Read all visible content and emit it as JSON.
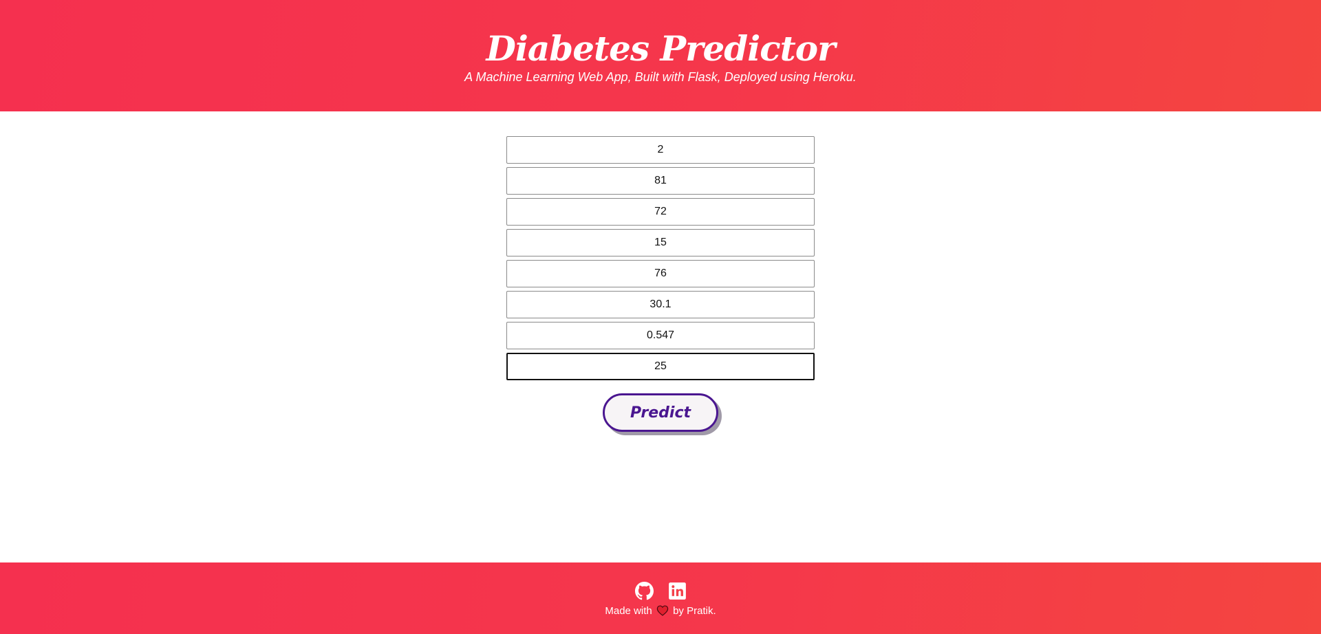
{
  "header": {
    "title": "Diabetes Predictor",
    "subtitle": "A Machine Learning Web App, Built with Flask, Deployed using Heroku."
  },
  "form": {
    "fields": [
      {
        "value": "2"
      },
      {
        "value": "81"
      },
      {
        "value": "72"
      },
      {
        "value": "15"
      },
      {
        "value": "76"
      },
      {
        "value": "30.1"
      },
      {
        "value": "0.547"
      },
      {
        "value": "25",
        "focused": true
      }
    ],
    "submit_label": "Predict"
  },
  "footer": {
    "icons": [
      "github-icon",
      "linkedin-icon",
      "heart-icon"
    ],
    "made_with": "Made with",
    "by": "by Pratik."
  },
  "colors": {
    "header_bg": "#f5374b",
    "accent": "#4a1690",
    "heart": "#e0202e"
  }
}
